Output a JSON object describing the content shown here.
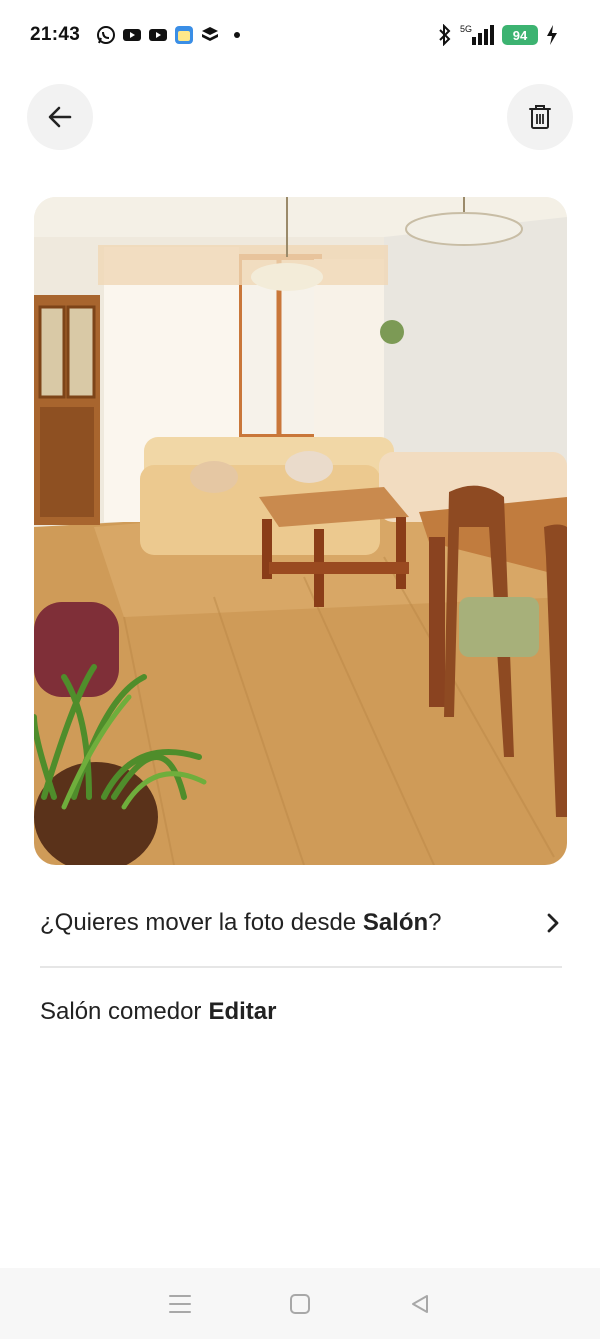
{
  "status_bar": {
    "time": "21:43",
    "left_icons": [
      "whatsapp-icon",
      "youtube-icon",
      "youtube-icon",
      "calendar-app-icon",
      "stack-app-icon"
    ],
    "network_label": "5G",
    "battery_level": "94"
  },
  "toolbar": {
    "back_icon": "arrow-left-icon",
    "delete_icon": "trash-icon"
  },
  "photo": {
    "subject": "living-dining room"
  },
  "move_row": {
    "prefix": "¿Quieres mover la foto desde ",
    "room": "Salón",
    "suffix": "?",
    "icon": "chevron-right-icon"
  },
  "room_row": {
    "room_name": "Salón comedor",
    "edit_label": "Editar"
  },
  "nav": {
    "items": [
      "menu-icon",
      "home-icon",
      "back-icon"
    ]
  },
  "colors": {
    "accent": "#222222",
    "button_bg": "#f2f2f2",
    "battery": "#3cb371",
    "divider": "#e6e6e6"
  }
}
